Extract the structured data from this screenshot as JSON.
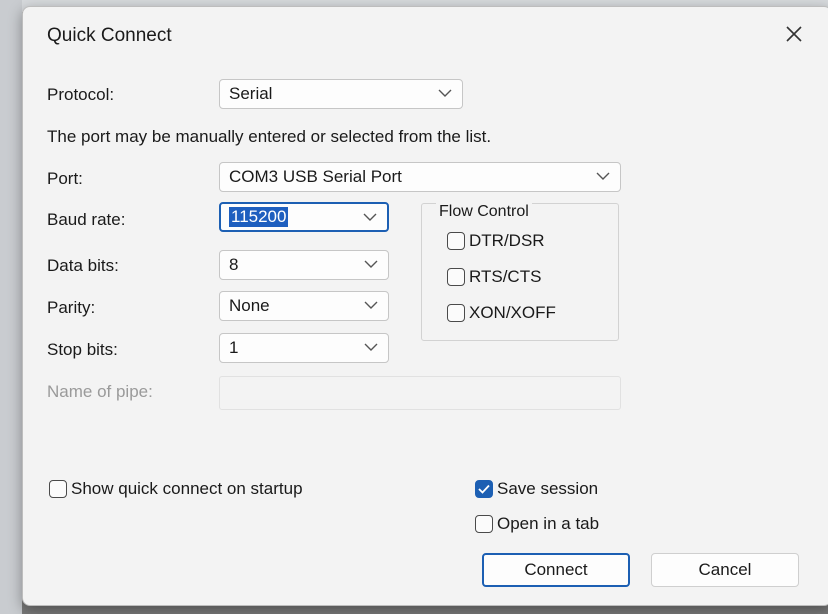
{
  "window": {
    "title": "Quick Connect"
  },
  "protocol": {
    "label": "Protocol:",
    "value": "Serial"
  },
  "note": "The port may be manually entered or selected from the list.",
  "port": {
    "label": "Port:",
    "value": "COM3 USB Serial Port"
  },
  "baud": {
    "label": "Baud rate:",
    "value": "115200"
  },
  "databits": {
    "label": "Data bits:",
    "value": "8"
  },
  "parity": {
    "label": "Parity:",
    "value": "None"
  },
  "stopbits": {
    "label": "Stop bits:",
    "value": "1"
  },
  "pipe": {
    "label": "Name of pipe:",
    "value": ""
  },
  "flow": {
    "legend": "Flow Control",
    "options": [
      {
        "label": "DTR/DSR",
        "checked": false
      },
      {
        "label": "RTS/CTS",
        "checked": false
      },
      {
        "label": "XON/XOFF",
        "checked": false
      }
    ]
  },
  "options": {
    "show_on_startup": {
      "label": "Show quick connect on startup",
      "checked": false
    },
    "save_session": {
      "label": "Save session",
      "checked": true
    },
    "open_in_tab": {
      "label": "Open in a tab",
      "checked": false
    }
  },
  "buttons": {
    "connect": "Connect",
    "cancel": "Cancel"
  },
  "colors": {
    "accent": "#1c5fb3",
    "dialog_bg": "#f3f3f3"
  },
  "icons": {
    "close": "close-icon",
    "dropdown": "chevron-down-icon",
    "check": "checkmark-icon"
  }
}
